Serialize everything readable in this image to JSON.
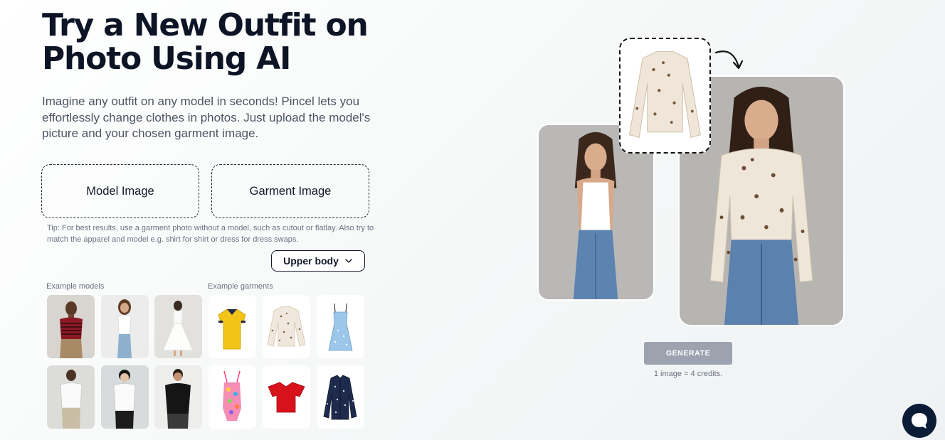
{
  "hero": {
    "title": "Try a New Outfit on Photo Using AI",
    "description": "Imagine any outfit on any model in seconds! Pincel lets you effortlessly change clothes in photos. Just upload the model's picture and your chosen garment image."
  },
  "upload": {
    "model_label": "Model Image",
    "garment_label": "Garment Image"
  },
  "tip": "Tip: For best results, use a garment photo without a model, such as cutout or flatlay. Also try to match the apparel and model e.g. shirt for shirt or dress for dress swaps.",
  "body_select": {
    "selected": "Upper body",
    "icon": "chevron-down-icon"
  },
  "examples": {
    "models_label": "Example models",
    "garments_label": "Example garments",
    "models": [
      "woman in red striped top",
      "woman in white tank top",
      "woman in white dress",
      "man in white t-shirt",
      "young man in white t-shirt",
      "man in black t-shirt"
    ],
    "garments": [
      "yellow polo shirt",
      "floral blouse",
      "blue sundress",
      "colorful swimsuit",
      "red top",
      "navy floral shirt"
    ]
  },
  "preview": {
    "before": "model in white tank top and jeans",
    "garment": "floral ruffle blouse",
    "after": "model wearing floral blouse and jeans",
    "arrow_icon": "curved-arrow-icon"
  },
  "generate": {
    "label": "GENERATE",
    "credits": "1 image = 4 credits."
  },
  "chat": {
    "icon": "chat-icon"
  },
  "colors": {
    "title": "#0c1426",
    "generate_disabled": "#9ca3af",
    "chat_bg": "#0a1b36"
  }
}
